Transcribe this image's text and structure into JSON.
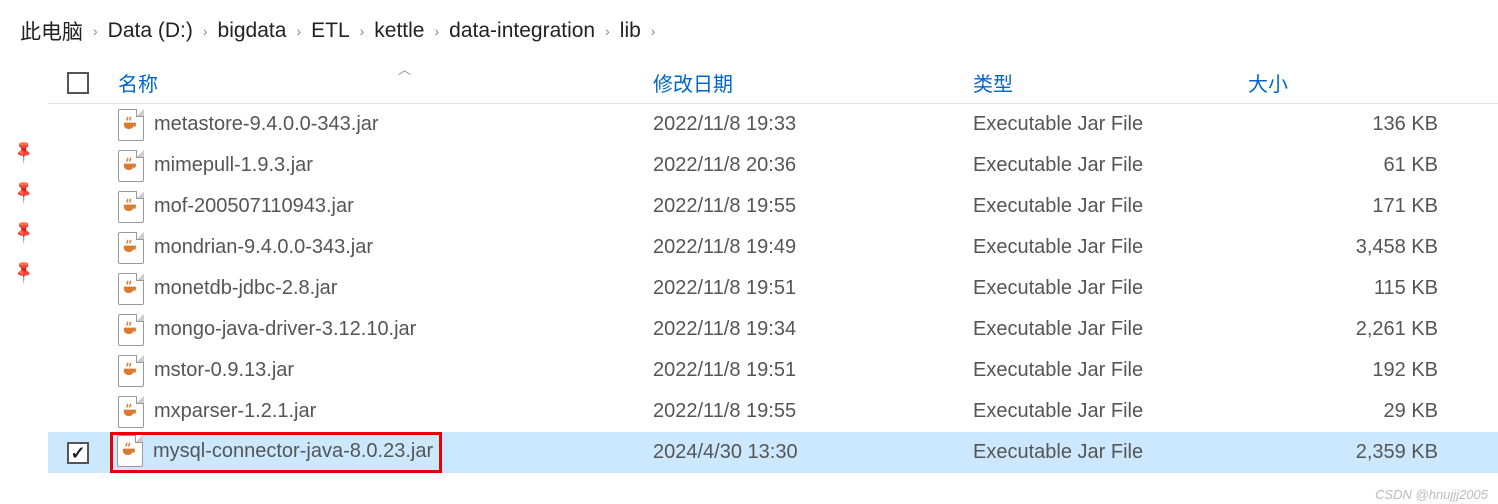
{
  "breadcrumb": [
    "此电脑",
    "Data (D:)",
    "bigdata",
    "ETL",
    "kettle",
    "data-integration",
    "lib"
  ],
  "columns": {
    "name": "名称",
    "date": "修改日期",
    "type": "类型",
    "size": "大小"
  },
  "files": [
    {
      "name": "metastore-9.4.0.0-343.jar",
      "date": "2022/11/8 19:33",
      "type": "Executable Jar File",
      "size": "136 KB",
      "selected": false,
      "highlighted": false
    },
    {
      "name": "mimepull-1.9.3.jar",
      "date": "2022/11/8 20:36",
      "type": "Executable Jar File",
      "size": "61 KB",
      "selected": false,
      "highlighted": false
    },
    {
      "name": "mof-200507110943.jar",
      "date": "2022/11/8 19:55",
      "type": "Executable Jar File",
      "size": "171 KB",
      "selected": false,
      "highlighted": false
    },
    {
      "name": "mondrian-9.4.0.0-343.jar",
      "date": "2022/11/8 19:49",
      "type": "Executable Jar File",
      "size": "3,458 KB",
      "selected": false,
      "highlighted": false
    },
    {
      "name": "monetdb-jdbc-2.8.jar",
      "date": "2022/11/8 19:51",
      "type": "Executable Jar File",
      "size": "115 KB",
      "selected": false,
      "highlighted": false
    },
    {
      "name": "mongo-java-driver-3.12.10.jar",
      "date": "2022/11/8 19:34",
      "type": "Executable Jar File",
      "size": "2,261 KB",
      "selected": false,
      "highlighted": false
    },
    {
      "name": "mstor-0.9.13.jar",
      "date": "2022/11/8 19:51",
      "type": "Executable Jar File",
      "size": "192 KB",
      "selected": false,
      "highlighted": false
    },
    {
      "name": "mxparser-1.2.1.jar",
      "date": "2022/11/8 19:55",
      "type": "Executable Jar File",
      "size": "29 KB",
      "selected": false,
      "highlighted": false
    },
    {
      "name": "mysql-connector-java-8.0.23.jar",
      "date": "2024/4/30 13:30",
      "type": "Executable Jar File",
      "size": "2,359 KB",
      "selected": true,
      "highlighted": true
    }
  ],
  "watermark": "CSDN @hnujjj2005"
}
